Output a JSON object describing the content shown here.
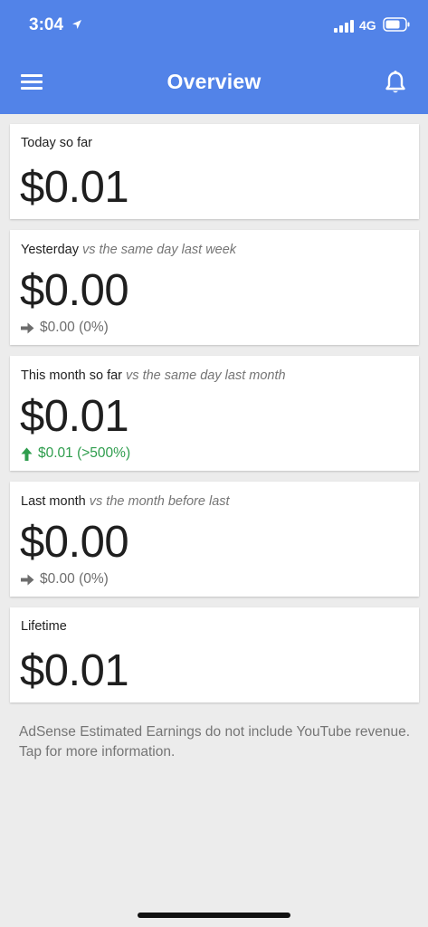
{
  "status_bar": {
    "time": "3:04",
    "network": "4G"
  },
  "header": {
    "title": "Overview"
  },
  "cards": [
    {
      "label": "Today so far",
      "comparison": "",
      "value": "$0.01",
      "change": "",
      "trend": ""
    },
    {
      "label": "Yesterday",
      "comparison": "vs the same day last week",
      "value": "$0.00",
      "change": "$0.00 (0%)",
      "trend": "flat"
    },
    {
      "label": "This month so far",
      "comparison": "vs the same day last month",
      "value": "$0.01",
      "change": "$0.01 (>500%)",
      "trend": "up"
    },
    {
      "label": "Last month",
      "comparison": "vs the month before last",
      "value": "$0.00",
      "change": "$0.00 (0%)",
      "trend": "flat"
    },
    {
      "label": "Lifetime",
      "comparison": "",
      "value": "$0.01",
      "change": "",
      "trend": ""
    }
  ],
  "footnote": "AdSense Estimated Earnings do not include YouTube revenue. Tap for more information.",
  "colors": {
    "header": "#5283e8",
    "background": "#ececec",
    "positive": "#2e9d4d",
    "neutral": "#6d6d6d"
  },
  "icons": {
    "menu": "menu-icon",
    "notifications": "bell-icon",
    "flat_trend": "arrow-right-icon",
    "up_trend": "arrow-up-icon"
  }
}
